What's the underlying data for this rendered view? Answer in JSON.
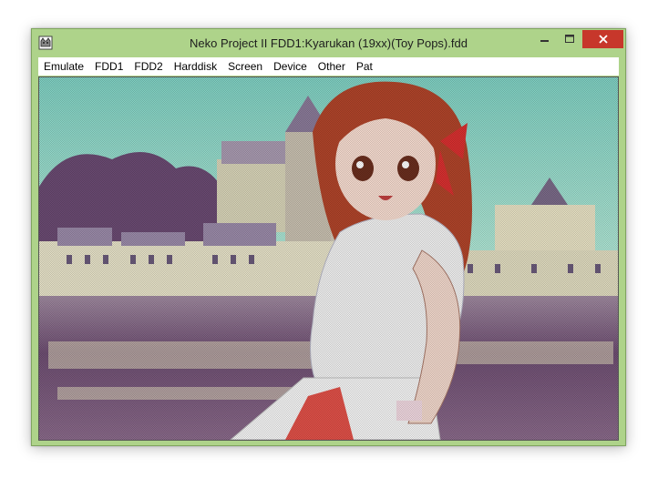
{
  "window": {
    "title": "Neko Project II  FDD1:Kyarukan (19xx)(Toy Pops).fdd",
    "icon": "cat-icon",
    "frame_color": "#aed38a",
    "close_color": "#c7372b"
  },
  "menu": {
    "items": [
      {
        "label": "Emulate"
      },
      {
        "label": "FDD1"
      },
      {
        "label": "FDD2"
      },
      {
        "label": "Harddisk"
      },
      {
        "label": "Screen"
      },
      {
        "label": "Device"
      },
      {
        "label": "Other"
      },
      {
        "label": "Pat"
      }
    ]
  },
  "screen": {
    "content": "emulated-display",
    "palette": {
      "sky": "#8ed8c8",
      "castle": "#e8e4c8",
      "water": "#7a5a7a",
      "hair": "#b0442a",
      "shirt": "#f0f0f0",
      "skirt": "#e05048"
    }
  }
}
